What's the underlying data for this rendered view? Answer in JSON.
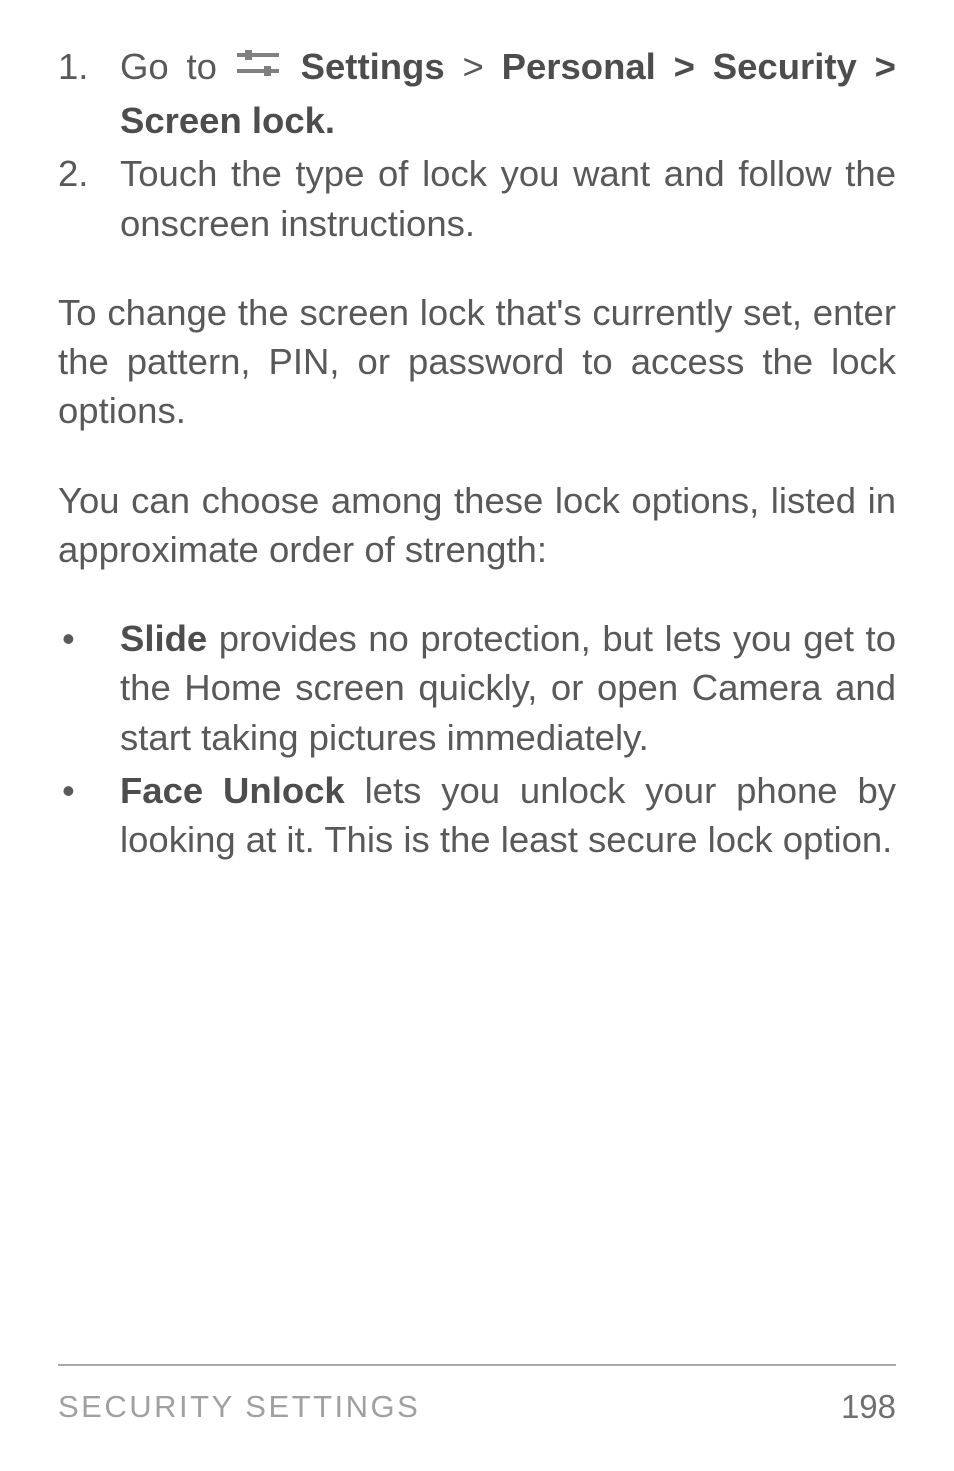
{
  "list1": {
    "items": [
      {
        "num": "1.",
        "prefix": "Go to ",
        "afterIcon": " ",
        "bold1": "Settings",
        "mid1": " > ",
        "bold2": "Personal > Security > Screen lock."
      },
      {
        "num": "2.",
        "text": "Touch the type of lock you want and fol­low the onscreen instructions."
      }
    ]
  },
  "para1": "To change the screen lock that's currently set, enter the pattern, PIN, or password to ac­cess the lock options.",
  "para2": "You can choose among these lock options, listed in approximate order of strength:",
  "list2": {
    "items": [
      {
        "bullet": "•",
        "bold": "Slide",
        "rest": " provides no protection, but lets you get to the Home screen quickly, or open Camera and start taking pictures immediately."
      },
      {
        "bullet": "•",
        "bold": "Face Unlock",
        "rest": " lets you unlock your phone by looking at it. This is the least secure lock option."
      }
    ]
  },
  "footer": {
    "section": "SECURITY SETTINGS",
    "page": "198"
  },
  "icons": {
    "settings": "settings-icon"
  }
}
